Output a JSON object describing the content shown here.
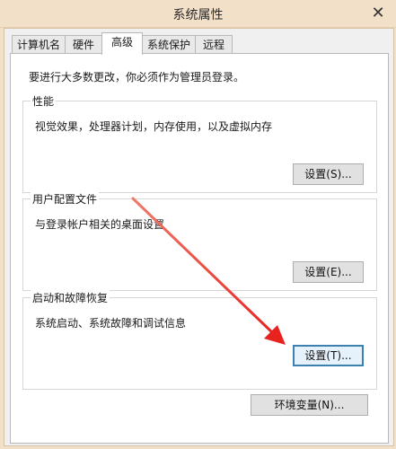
{
  "window": {
    "title": "系统属性",
    "close_label": "✕"
  },
  "tabs": [
    {
      "label": "计算机名"
    },
    {
      "label": "硬件"
    },
    {
      "label": "高级"
    },
    {
      "label": "系统保护"
    },
    {
      "label": "远程"
    }
  ],
  "active_tab": "高级",
  "intro_text": "要进行大多数更改，你必须作为管理员登录。",
  "groups": {
    "performance": {
      "title": "性能",
      "description": "视觉效果，处理器计划，内存使用，以及虚拟内存",
      "button": "设置(S)..."
    },
    "user_profiles": {
      "title": "用户配置文件",
      "description": "与登录帐户相关的桌面设置",
      "button": "设置(E)..."
    },
    "startup_recovery": {
      "title": "启动和故障恢复",
      "description": "系统启动、系统故障和调试信息",
      "button": "设置(T)..."
    }
  },
  "env_button": "环境变量(N)...",
  "colors": {
    "frame": "#f3e0c8",
    "annotation_arrow": "#e8231f",
    "focus_border": "#3c7fb1"
  }
}
